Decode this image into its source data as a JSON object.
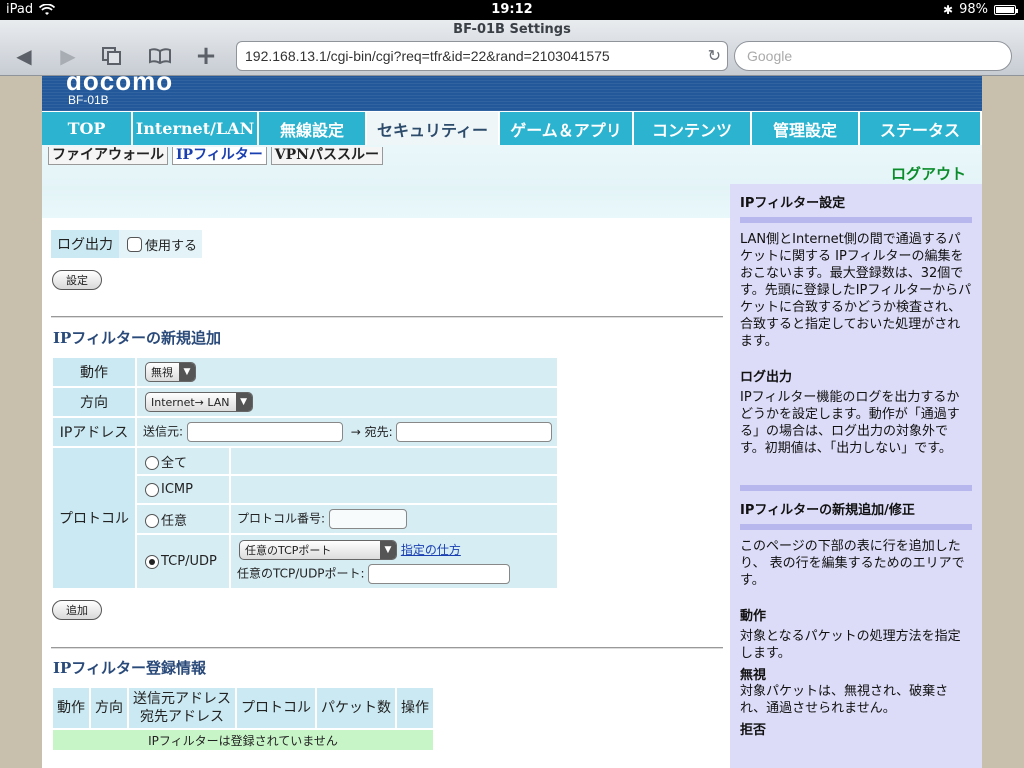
{
  "status": {
    "device": "iPad",
    "time": "19:12",
    "battery": "98%",
    "battery_level": 0.98
  },
  "browser": {
    "title": "BF-01B Settings",
    "url": "192.168.13.1/cgi-bin/cgi?req=tfr&id=22&rand=2103041575",
    "search_placeholder": "Google"
  },
  "header": {
    "logo": "docomo",
    "model": "BF-01B"
  },
  "main_nav": [
    "TOP",
    "Internet/LAN",
    "無線設定",
    "セキュリティー",
    "ゲーム＆アプリ",
    "コンテンツ",
    "管理設定",
    "ステータス"
  ],
  "main_nav_active": 3,
  "sub_nav": [
    "ファイアウォール",
    "IPフィルター",
    "VPNパススルー"
  ],
  "sub_nav_active": 1,
  "logout": "ログアウト",
  "log_output": {
    "label": "ログ出力",
    "checkbox_label": "使用する",
    "checked": false,
    "button": "設定"
  },
  "new_filter": {
    "title": "IPフィルターの新規追加",
    "action_label": "動作",
    "action_value": "無視",
    "direction_label": "方向",
    "direction_value": "Internet→ LAN",
    "ip_label": "IPアドレス",
    "src_label": "送信元:",
    "dst_label": "→ 宛先:",
    "protocol_label": "プロトコル",
    "protocols": [
      "全て",
      "ICMP",
      "任意",
      "TCP/UDP"
    ],
    "protocol_selected": "TCP/UDP",
    "protocol_number_label": "プロトコル番号:",
    "tcp_port_select": "任意のTCPポート",
    "how_to_link": "指定の仕方",
    "tcpudp_port_label": "任意のTCP/UDPポート:",
    "add_button": "追加"
  },
  "registered": {
    "title": "IPフィルター登録情報",
    "columns": [
      "動作",
      "方向",
      "送信元アドレス",
      "宛先アドレス",
      "プロトコル",
      "パケット数",
      "操作"
    ],
    "empty_message": "IPフィルターは登録されていません"
  },
  "sidebar": {
    "h1": "IPフィルター設定",
    "p1": "LAN側とInternet側の間で通過するパケットに関する IPフィルターの編集をおこないます。最大登録数は、32個です。先頭に登録したIPフィルターからパケットに合致するかどうか検査され、合致すると指定しておいた処理がされます。",
    "h2": "ログ出力",
    "p2": "IPフィルター機能のログを出力するかどうかを設定します。動作が「通過する」の場合は、ログ出力の対象外です。初期値は、「出力しない」です。",
    "h3": "IPフィルターの新規追加/修正",
    "p3": "このページの下部の表に行を追加したり、 表の行を編集するためのエリアです。",
    "h4": "動作",
    "p4": "対象となるパケットの処理方法を指定します。",
    "h5": "無視",
    "p5": "対象パケットは、無視され、破棄され、通過させられません。",
    "h6": "拒否"
  }
}
